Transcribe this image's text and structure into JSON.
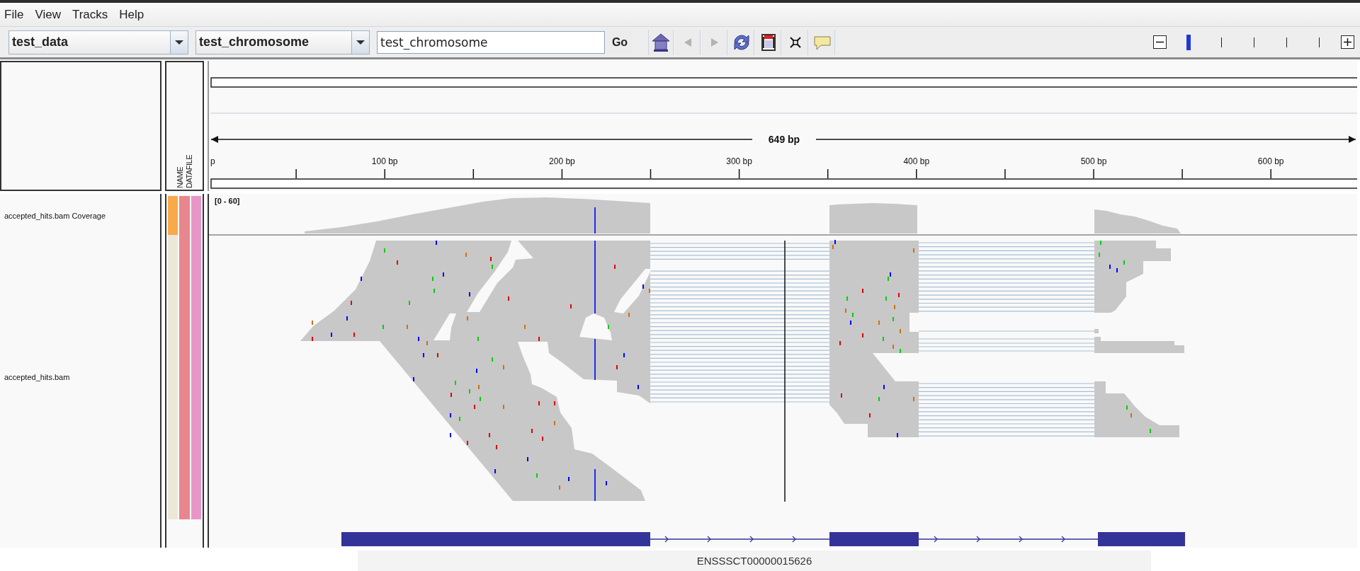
{
  "menu": [
    {
      "label": "File"
    },
    {
      "label": "View"
    },
    {
      "label": "Tracks"
    },
    {
      "label": "Help"
    }
  ],
  "toolbar": {
    "genome": {
      "value": "test_data"
    },
    "chromosome": {
      "value": "test_chromosome"
    },
    "locus": {
      "value": "test_chromosome"
    },
    "go": "Go",
    "buttons": [
      {
        "kind": "home",
        "disabled": false
      },
      {
        "kind": "back",
        "disabled": true
      },
      {
        "kind": "forward",
        "disabled": true
      },
      {
        "kind": "refresh",
        "disabled": false
      },
      {
        "kind": "region",
        "disabled": false
      },
      {
        "kind": "fit",
        "disabled": false
      },
      {
        "kind": "popup",
        "disabled": false
      }
    ],
    "zoom_levels": [
      {
        "selected": true
      },
      {
        "selected": false
      },
      {
        "selected": false
      },
      {
        "selected": false
      },
      {
        "selected": false
      }
    ]
  },
  "attribute_columns": [
    "NAME",
    "DATAFILE"
  ],
  "ruler": {
    "span": "649 bp",
    "ticks": [
      "p",
      "100 bp",
      "200 bp",
      "300 bp",
      "400 bp",
      "500 bp",
      "600 bp"
    ]
  },
  "tracks": [
    {
      "kind": "coverage",
      "name": "accepted_hits.bam Coverage",
      "range": "[0 - 60]",
      "attributes": [
        {
          "color": "#f8a94a"
        },
        {
          "color": "#e8868e"
        },
        {
          "color": "#e896c8"
        }
      ]
    },
    {
      "kind": "alignments",
      "name": "accepted_hits.bam",
      "attributes": [
        {
          "color": "#ece8d8"
        },
        {
          "color": "#e8868e"
        },
        {
          "color": "#e896c8"
        }
      ]
    },
    {
      "kind": "gene",
      "feature": "ENSSSCT00000015626"
    }
  ]
}
